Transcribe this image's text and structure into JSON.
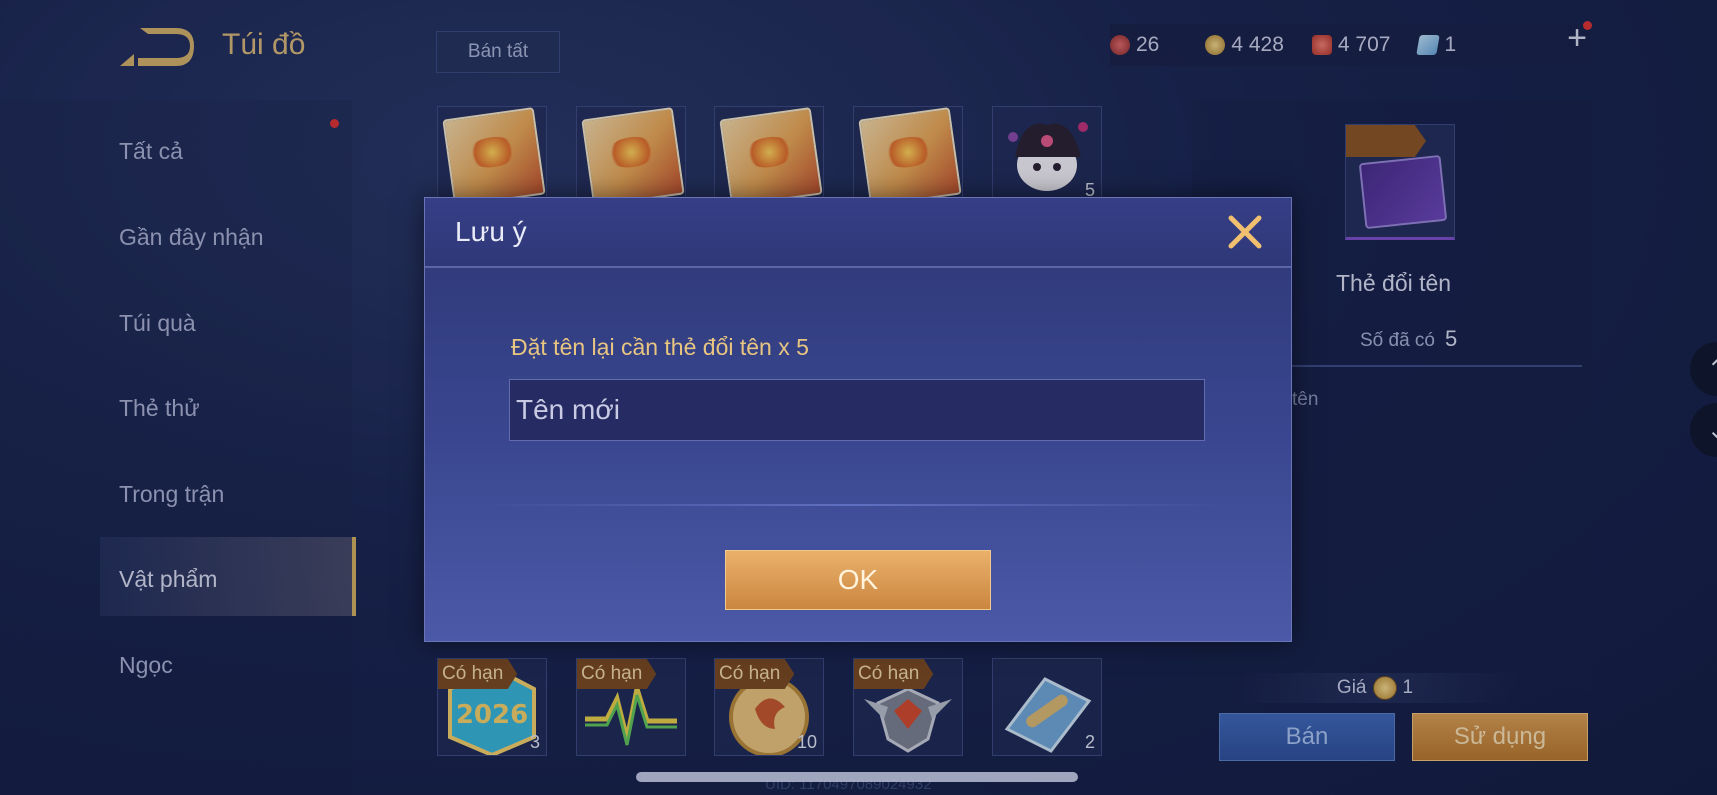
{
  "header": {
    "title": "Túi đồ",
    "sell_all_label": "Bán tất",
    "currencies": [
      {
        "icon": "red-gem-icon",
        "value": "26",
        "color": "#c94b4b"
      },
      {
        "icon": "gold-coin-icon",
        "value": "4 428",
        "color": "#d8b65a"
      },
      {
        "icon": "red-voucher-icon",
        "value": "4 707",
        "color": "#d84b3d"
      },
      {
        "icon": "blue-card-icon",
        "value": "1",
        "color": "#8fc0ea"
      }
    ],
    "plus_label": "+"
  },
  "sidebar": {
    "items": [
      {
        "label": "Tất cả"
      },
      {
        "label": "Gần đây nhận"
      },
      {
        "label": "Túi quà"
      },
      {
        "label": "Thẻ thử"
      },
      {
        "label": "Trong trận"
      },
      {
        "label": "Vật phẩm",
        "active": true
      },
      {
        "label": "Ngọc"
      }
    ]
  },
  "grid": {
    "top_row": [
      {
        "icon": "name-card-icon",
        "count": ""
      },
      {
        "icon": "name-card-icon",
        "count": ""
      },
      {
        "icon": "name-card-icon",
        "count": ""
      },
      {
        "icon": "name-card-icon",
        "count": ""
      },
      {
        "icon": "kuromi-icon",
        "count": "5"
      }
    ],
    "bottom_row": [
      {
        "icon": "badge-2026-icon",
        "tag": "Có hạn",
        "count": "3"
      },
      {
        "icon": "pulse-icon",
        "tag": "Có hạn",
        "count": ""
      },
      {
        "icon": "medal-icon",
        "tag": "Có hạn",
        "count": "10"
      },
      {
        "icon": "rank-emblem-icon",
        "tag": "Có hạn",
        "count": ""
      },
      {
        "icon": "scroll-map-icon",
        "tag": "",
        "count": "2"
      }
    ]
  },
  "detail": {
    "name": "Thẻ đổi tên",
    "owned_label": "Số đã có",
    "owned_value": "5",
    "description_fragment": "tên",
    "price_label": "Giá",
    "price_value": "1",
    "sell_label": "Bán",
    "use_label": "Sử dụng"
  },
  "dialog": {
    "title": "Lưu ý",
    "message": "Đặt tên lại cần thẻ đổi tên x 5",
    "input_placeholder": "Tên mới",
    "ok_label": "OK"
  },
  "footer": {
    "uid": "UID: 1170497089024932"
  }
}
